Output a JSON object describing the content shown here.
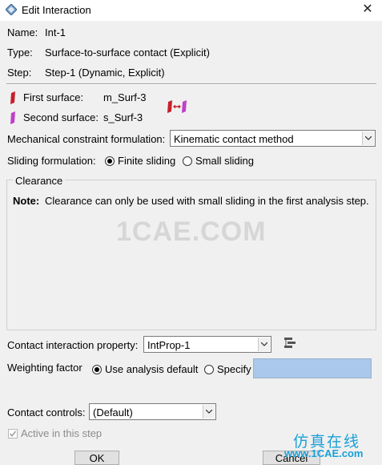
{
  "window": {
    "title": "Edit Interaction",
    "close_glyph": "✕"
  },
  "info": {
    "name_label": "Name:",
    "name_value": "Int-1",
    "type_label": "Type:",
    "type_value": "Surface-to-surface contact (Explicit)",
    "step_label": "Step:",
    "step_value": "Step-1 (Dynamic, Explicit)"
  },
  "surfaces": {
    "first_label": "First surface:",
    "first_value": "m_Surf-3",
    "first_color": "#c8202a",
    "second_label": "Second surface:",
    "second_value": "s_Surf-3",
    "second_color": "#c040c8"
  },
  "mechanical": {
    "label": "Mechanical constraint formulation:",
    "selected": "Kinematic contact method"
  },
  "sliding": {
    "label": "Sliding formulation:",
    "options": [
      "Finite sliding",
      "Small sliding"
    ],
    "selected_index": 0
  },
  "clearance": {
    "title": "Clearance",
    "note_label": "Note:",
    "note_text": "Clearance can only be used with small sliding in the first analysis step."
  },
  "watermark": {
    "main": "1CAE.COM",
    "cn": "仿真在线",
    "url": "www.1CAE.com"
  },
  "property": {
    "label": "Contact interaction property:",
    "selected": "IntProp-1",
    "icon": "property-manager-icon"
  },
  "weighting": {
    "label": "Weighting factor",
    "options": [
      "Use analysis default",
      "Specify"
    ],
    "selected_index": 0,
    "specify_value": ""
  },
  "controls": {
    "label": "Contact controls:",
    "selected": "(Default)"
  },
  "active": {
    "label": "Active in this step",
    "checked": true
  },
  "buttons": {
    "ok": "OK",
    "cancel": "Cancel"
  }
}
